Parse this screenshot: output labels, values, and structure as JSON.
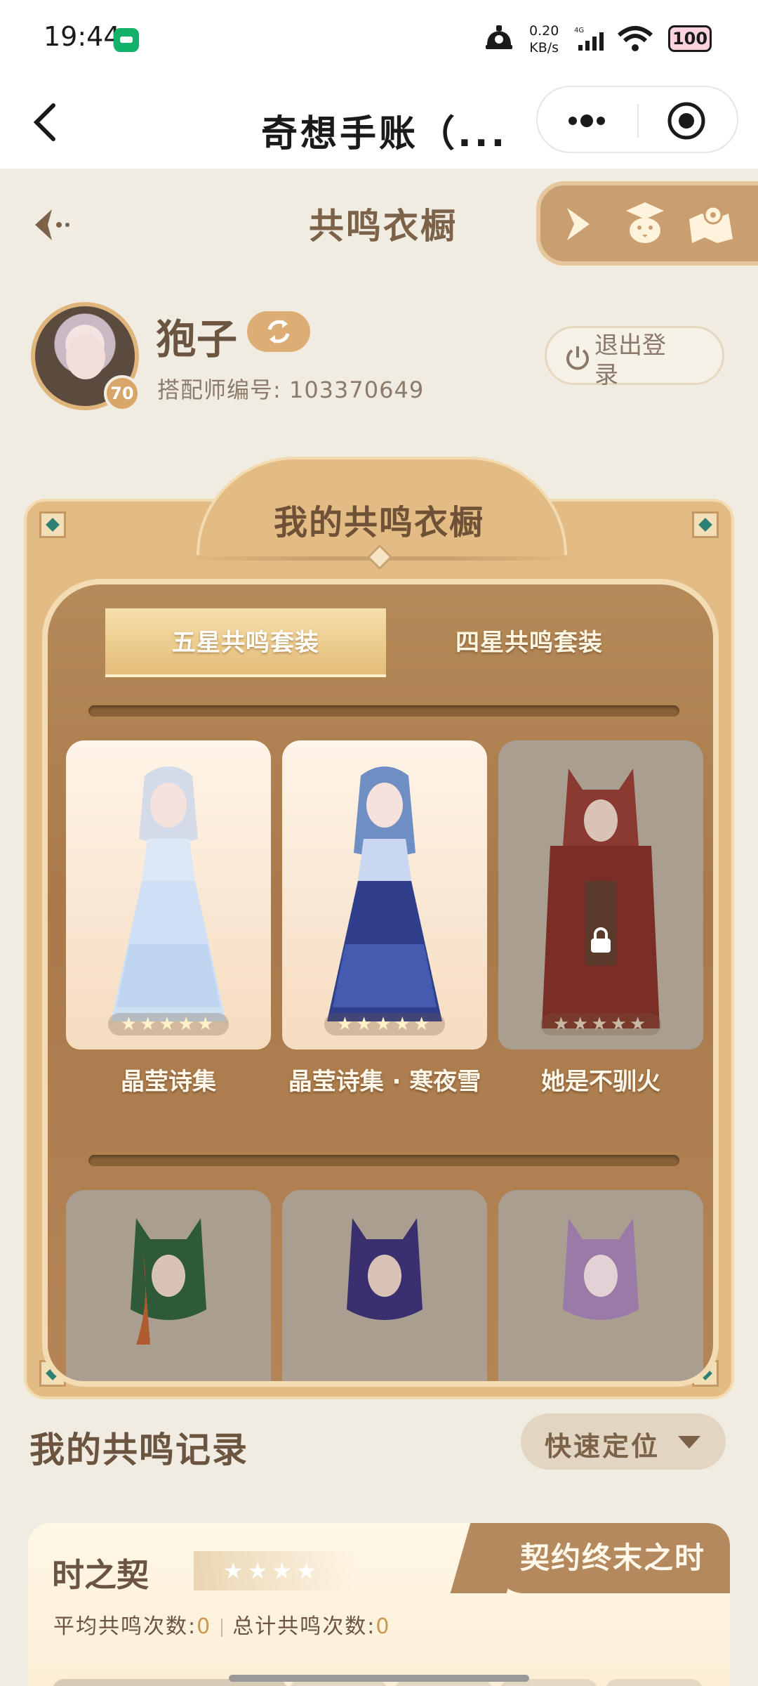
{
  "status_bar": {
    "time": "19:44",
    "net_speed_value": "0.20",
    "net_speed_unit": "KB/s",
    "network_type": "4G",
    "battery": "100"
  },
  "title_bar": {
    "title": "奇想手账（..."
  },
  "header": {
    "title": "共鸣衣橱"
  },
  "profile": {
    "name": "狍子",
    "level": "70",
    "stylist_id": "搭配师编号: 103370649",
    "logout_label": "退出登录"
  },
  "wardrobe": {
    "title": "我的共鸣衣橱",
    "tabs": [
      {
        "label": "五星共鸣套装",
        "active": true
      },
      {
        "label": "四星共鸣套装",
        "active": false
      }
    ],
    "items": [
      {
        "name": "晶莹诗集",
        "owned": true,
        "stars": "★★★★★"
      },
      {
        "name": "晶莹诗集 · 寒夜雪",
        "owned": true,
        "stars": "★★★★★"
      },
      {
        "name": "她是不驯火",
        "owned": false,
        "stars": "★★★★★"
      },
      {
        "name": "",
        "owned": false
      },
      {
        "name": "",
        "owned": false
      },
      {
        "name": "",
        "owned": false
      }
    ]
  },
  "records": {
    "title": "我的共鸣记录",
    "quick_locate_label": "快速定位",
    "entry": {
      "name": "时之契",
      "stars": "★★★★",
      "tab_label": "契约终末之时",
      "avg_label": "平均共鸣次数:",
      "avg_value": "0",
      "total_label": "总计共鸣次数:",
      "total_value": "0"
    }
  },
  "colors": {
    "accent": "#dcae76",
    "wood": "#a9794a",
    "frame": "#e2bc84",
    "text_brown": "#6b5440"
  },
  "icons": [
    "back-arrow-icon",
    "more-dots-icon",
    "mini-program-target-icon",
    "fancy-back-icon",
    "play-arrow-icon",
    "tutor-icon",
    "map-icon",
    "swap-icon",
    "power-icon",
    "lock-icon",
    "chevron-down-icon"
  ]
}
